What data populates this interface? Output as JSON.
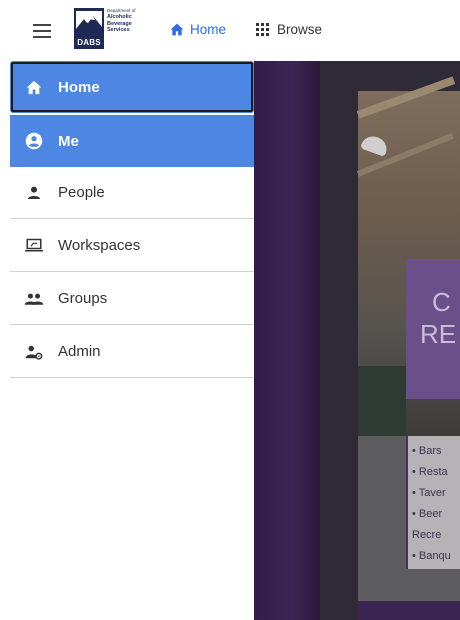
{
  "header": {
    "logo": {
      "abbr": "DABS",
      "lines": [
        "Department of",
        "Alcoholic",
        "Beverage",
        "Services"
      ]
    },
    "nav": {
      "home_label": "Home",
      "browse_label": "Browse"
    }
  },
  "sidebar": {
    "items": [
      {
        "label": "Home",
        "icon": "home-icon",
        "active": true,
        "focused": true
      },
      {
        "label": "Me",
        "icon": "account-circle-icon",
        "active": true
      },
      {
        "label": "People",
        "icon": "person-icon"
      },
      {
        "label": "Workspaces",
        "icon": "laptop-icon"
      },
      {
        "label": "Groups",
        "icon": "group-icon"
      },
      {
        "label": "Admin",
        "icon": "admin-person-gear-icon"
      }
    ]
  },
  "background_content": {
    "heading_fragment": [
      "C",
      "RE"
    ],
    "list_fragments": [
      "• Bars",
      "• Resta",
      "• Taver",
      "• Beer",
      "  Recre",
      "• Banqu"
    ]
  },
  "colors": {
    "accent_blue": "#4d86e3",
    "nav_blue": "#2e6be6",
    "brand_navy": "#1e2a55",
    "backdrop_purple": "#3a2452"
  }
}
